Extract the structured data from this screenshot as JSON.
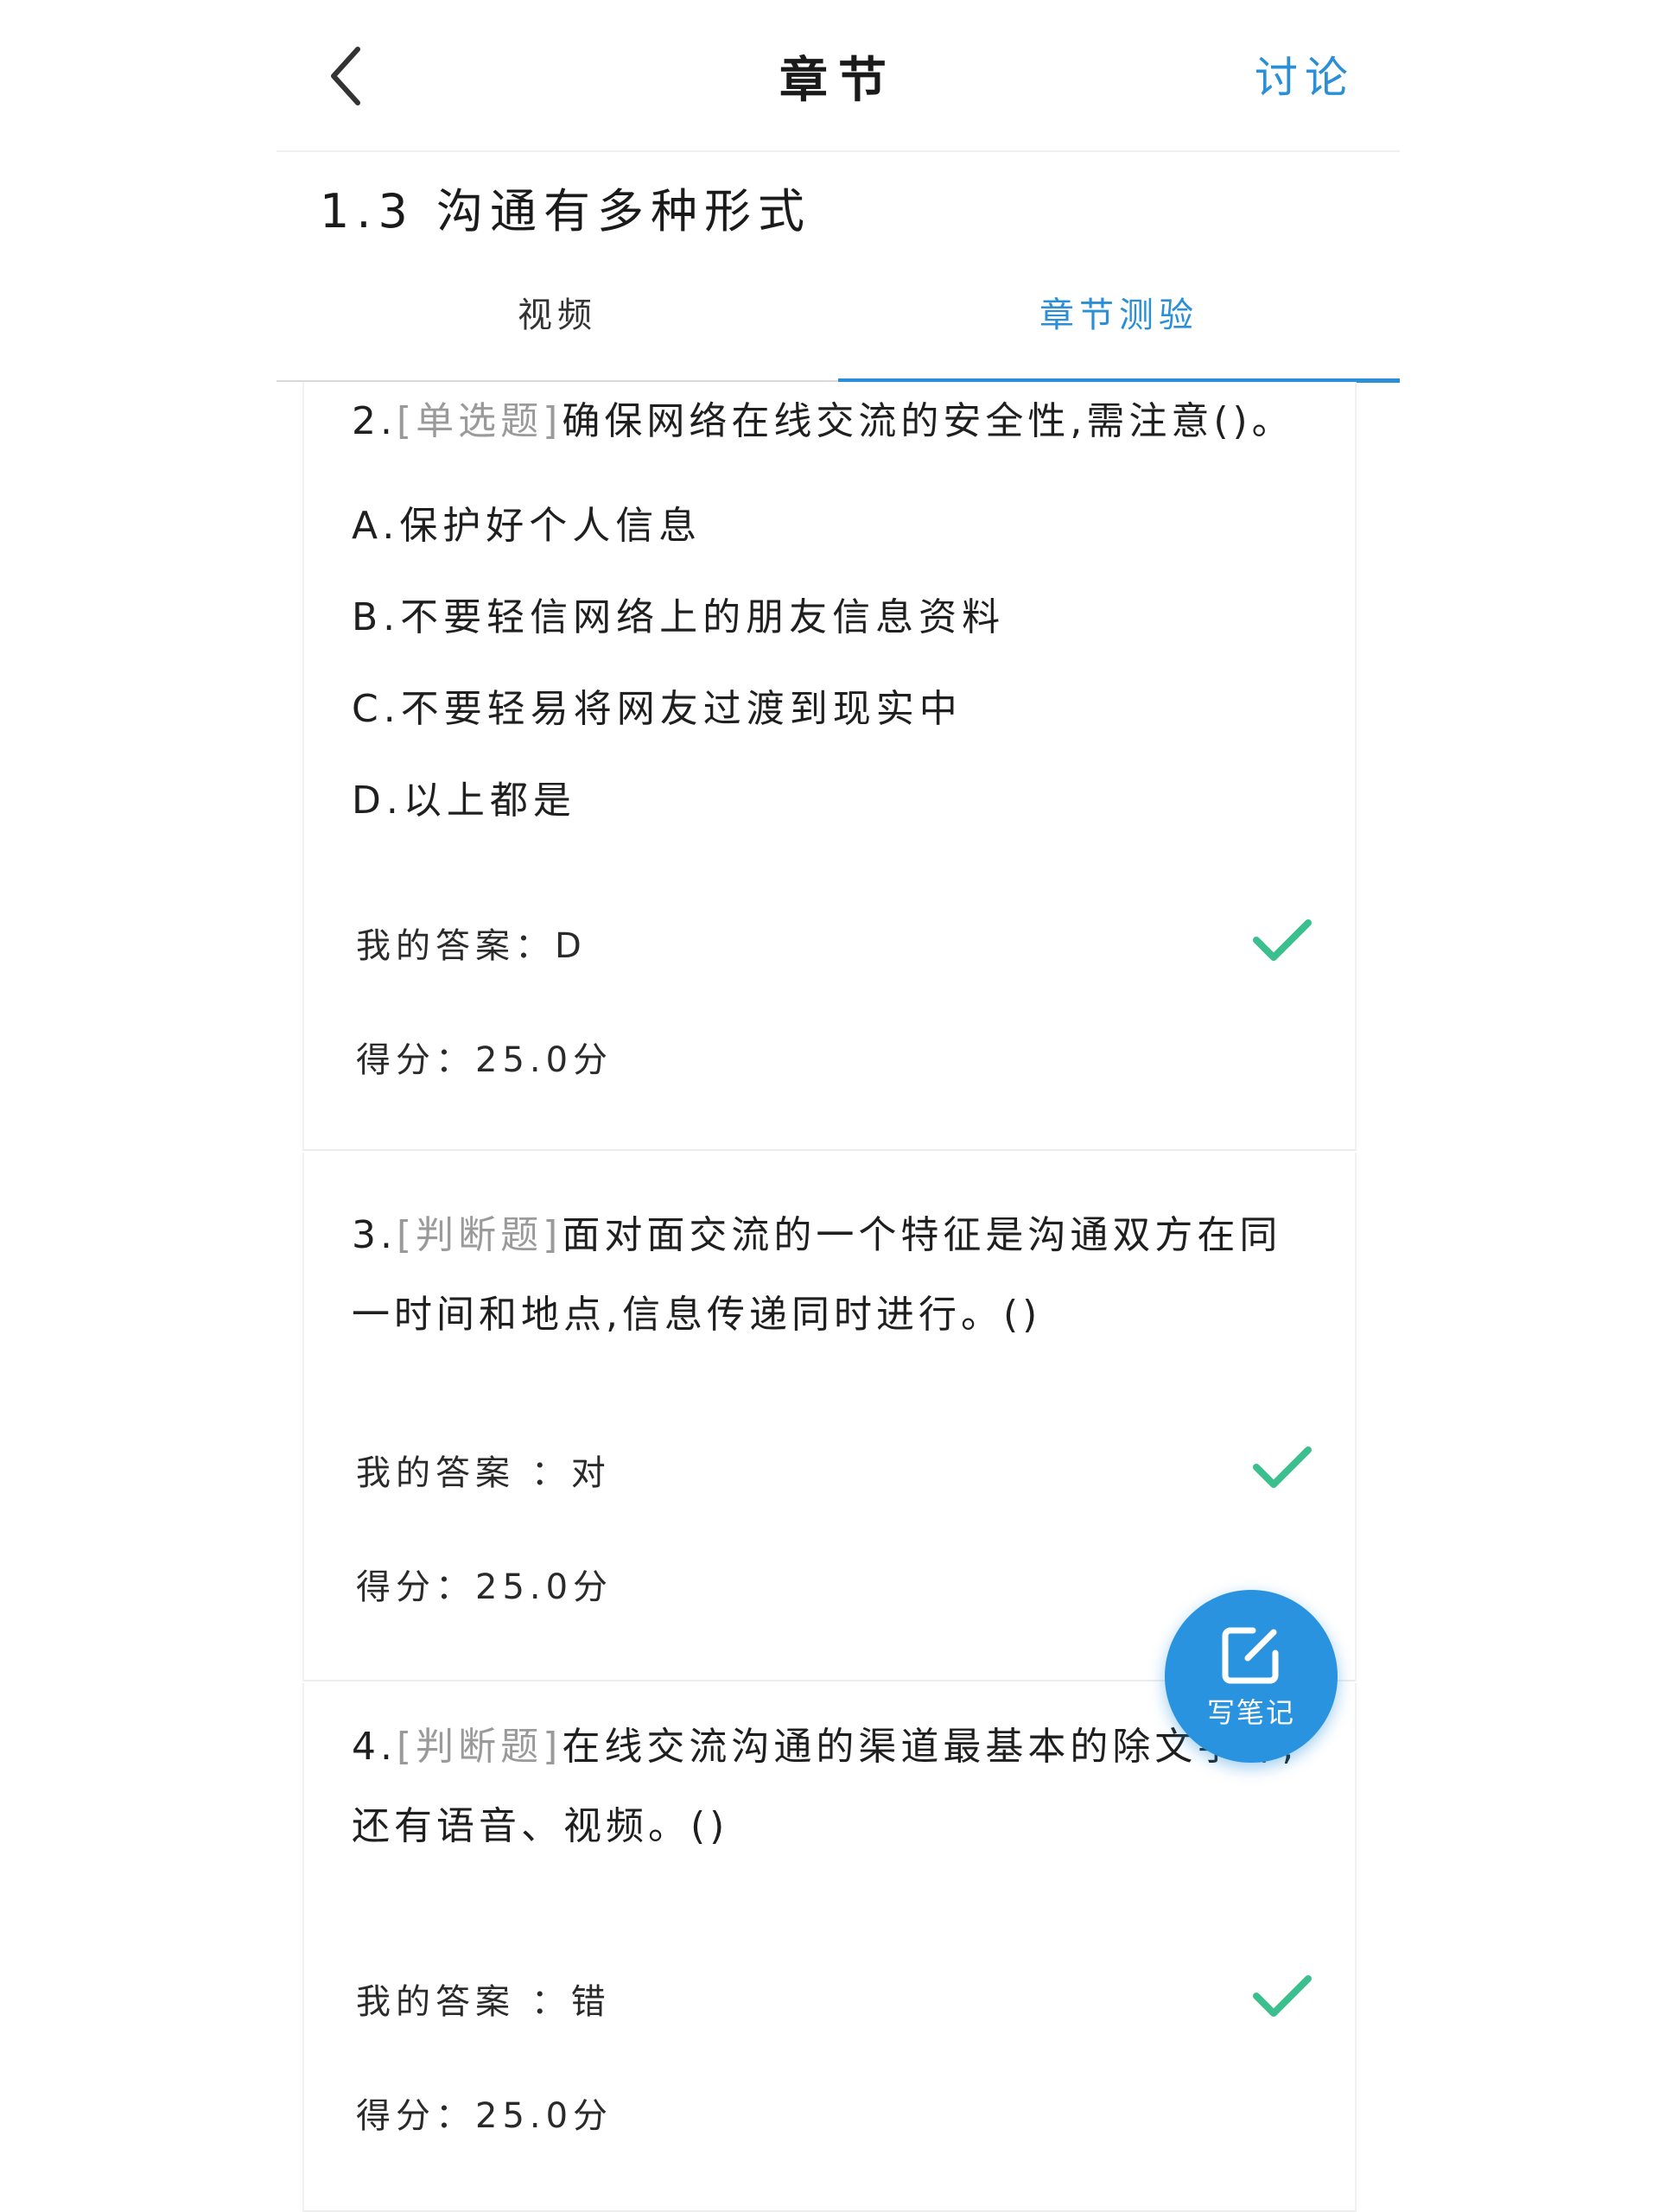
{
  "header": {
    "title": "章节",
    "discuss_label": "讨论"
  },
  "section": {
    "title": "1.3 沟通有多种形式"
  },
  "tabs": [
    {
      "label": "视频",
      "active": false
    },
    {
      "label": "章节测验",
      "active": true
    }
  ],
  "colors": {
    "accent": "#2a8fd6",
    "check": "#3cbf8f",
    "fab": "#2a93e0"
  },
  "questions": [
    {
      "number": "2.",
      "type": "[单选题]",
      "text": "确保网络在线交流的安全性,需注意()。",
      "options": [
        "A.保护好个人信息",
        "B.不要轻信网络上的朋友信息资料",
        "C.不要轻易将网友过渡到现实中",
        "D.以上都是"
      ],
      "answer_label": "我的答案：D",
      "score_label": "得分：25.0分",
      "correct": true
    },
    {
      "number": "3.",
      "type": "[判断题]",
      "text": "面对面交流的一个特征是沟通双方在同一时间和地点,信息传递同时进行。()",
      "answer_label": "我的答案 ：对",
      "score_label": "得分：25.0分",
      "correct": true
    },
    {
      "number": "4.",
      "type": "[判断题]",
      "text": "在线交流沟通的渠道最基本的除文字外,还有语音、视频。()",
      "answer_label": "我的答案 ：错",
      "score_label": "得分：25.0分",
      "correct": true
    }
  ],
  "fab": {
    "label": "写笔记",
    "icon": "edit-note-icon"
  }
}
